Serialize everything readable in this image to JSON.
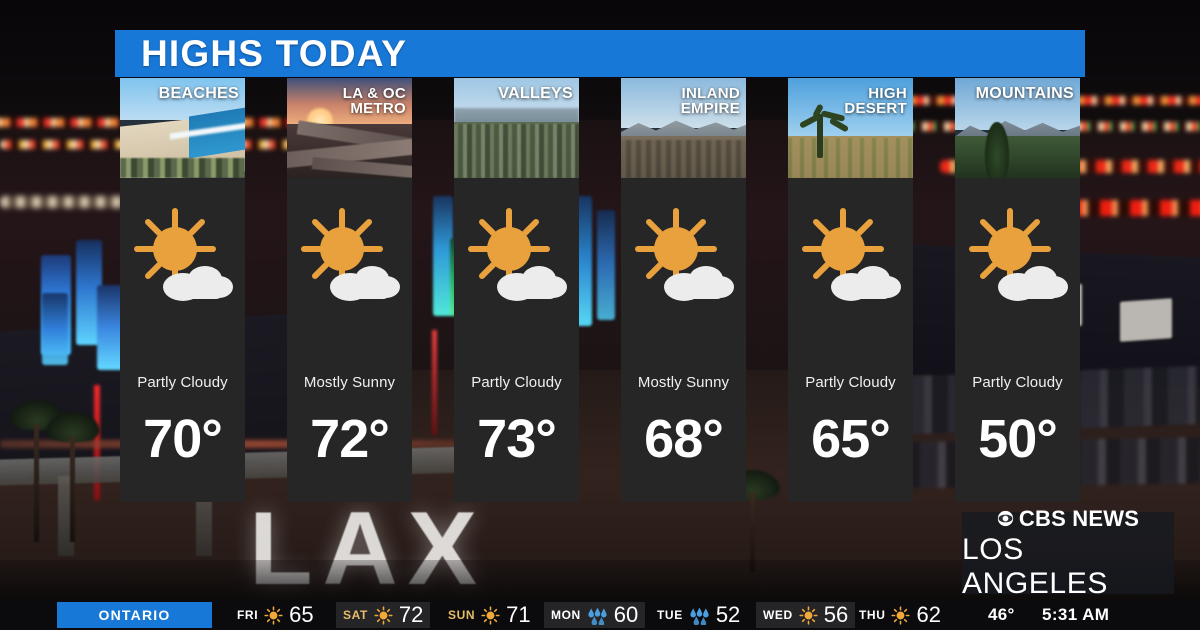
{
  "header": {
    "title": "HIGHS TODAY",
    "accent_color": "#1878d8"
  },
  "regions": [
    {
      "label_line1": "BEACHES",
      "label_line2": "",
      "art": "t-beach",
      "condition": "Partly Cloudy",
      "icon": "sun-cloud-icon",
      "high": "70°"
    },
    {
      "label_line1": "LA & OC",
      "label_line2": "METRO",
      "art": "t-metro",
      "condition": "Mostly Sunny",
      "icon": "sun-cloud-icon",
      "high": "72°"
    },
    {
      "label_line1": "VALLEYS",
      "label_line2": "",
      "art": "t-valley",
      "condition": "Partly Cloudy",
      "icon": "sun-cloud-icon",
      "high": "73°"
    },
    {
      "label_line1": "INLAND",
      "label_line2": "EMPIRE",
      "art": "t-inland",
      "condition": "Mostly Sunny",
      "icon": "sun-cloud-icon",
      "high": "68°"
    },
    {
      "label_line1": "HIGH",
      "label_line2": "DESERT",
      "art": "t-desert",
      "condition": "Partly Cloudy",
      "icon": "sun-cloud-icon",
      "high": "65°"
    },
    {
      "label_line1": "MOUNTAINS",
      "label_line2": "",
      "art": "t-mtn",
      "condition": "Partly Cloudy",
      "icon": "sun-cloud-icon",
      "high": "50°"
    }
  ],
  "logo": {
    "network": "CBS NEWS",
    "market": "LOS ANGELES",
    "eye": "cbs-eye-icon"
  },
  "background": {
    "scene_text": "LAX"
  },
  "ticker": {
    "city": "ONTARIO",
    "current_temp": "46°",
    "current_time": "5:31 AM",
    "days": [
      {
        "dow": "FRI",
        "icon": "sun-icon",
        "high": "65",
        "shaded": false
      },
      {
        "dow": "SAT",
        "icon": "sun-icon",
        "high": "72",
        "shaded": true
      },
      {
        "dow": "SUN",
        "icon": "sun-icon",
        "high": "71",
        "shaded": false
      },
      {
        "dow": "MON",
        "icon": "rain-icon",
        "high": "60",
        "shaded": true
      },
      {
        "dow": "TUE",
        "icon": "rain-icon",
        "high": "52",
        "shaded": false
      },
      {
        "dow": "WED",
        "icon": "sun-icon",
        "high": "56",
        "shaded": true
      },
      {
        "dow": "THU",
        "icon": "sun-icon",
        "high": "62",
        "shaded": false
      }
    ]
  },
  "colors": {
    "accent_blue": "#1878d8",
    "card_bg": "#262626",
    "sun_orange": "#e8a13c",
    "cloud_white": "#eeeeee",
    "rain_blue": "#4a9fe0",
    "gold_text": "#e8bd6a"
  }
}
